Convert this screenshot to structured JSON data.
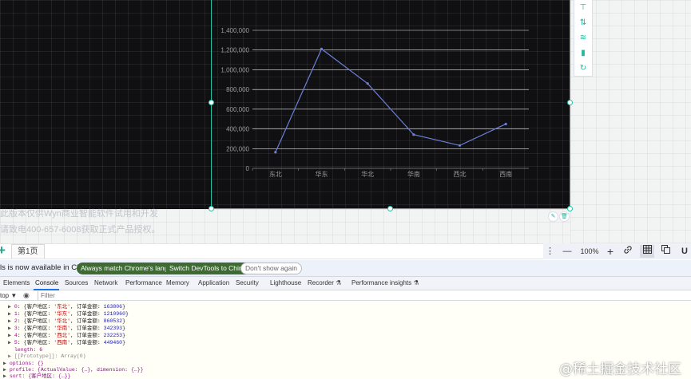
{
  "canvas": {
    "notice_line1": "此版本仅供Wyn商业智能软件试用和开发",
    "notice_line2": "请致电400-657-6008获取正式产品授权。",
    "side_toolbar": [
      {
        "icon": "filter-icon",
        "glyph": "⊤"
      },
      {
        "icon": "sort-icon",
        "glyph": "⇅"
      },
      {
        "icon": "analysis-icon",
        "glyph": "≋"
      },
      {
        "icon": "chart-type-icon",
        "glyph": "▮"
      },
      {
        "icon": "refresh-icon",
        "glyph": "↻"
      }
    ],
    "edit_glyph": "✎",
    "delete_glyph": "🗑"
  },
  "chart_data": {
    "type": "line",
    "categories": [
      "东北",
      "华东",
      "华北",
      "华南",
      "西北",
      "西南"
    ],
    "values": [
      163806,
      1210960,
      860532,
      342393,
      232253,
      449460
    ],
    "ylim": [
      0,
      1400000
    ],
    "y_ticks": [
      "0",
      "200,000",
      "400,000",
      "600,000",
      "800,000",
      "1,000,000",
      "1,200,000",
      "1,400,000"
    ],
    "grid": true,
    "colors": {
      "line": "#6a7fd6",
      "grid": "#e8e8e8"
    }
  },
  "page_bar": {
    "add_glyph": "+",
    "tab_label": "第1页",
    "devtools": {
      "more_glyph": "⋮",
      "zoom_out": "—",
      "zoom": "100%",
      "zoom_in": "+"
    }
  },
  "devtools": {
    "info_text": "ls is now available in Chinese!",
    "btn_match": "Always match Chrome's language",
    "btn_switch": "Switch DevTools to Chinese",
    "btn_dismiss": "Don't show again",
    "tabs": [
      "Elements",
      "Console",
      "Sources",
      "Network",
      "Performance",
      "Memory",
      "Application",
      "Security",
      "Lighthouse",
      "Recorder ⚗",
      "Performance insights ⚗"
    ],
    "active_tab": "Console",
    "context": "top ▼",
    "filter_placeholder": "Filter",
    "console_rows": [
      {
        "idx": "0",
        "region": "'东北'",
        "amount": "163806"
      },
      {
        "idx": "1",
        "region": "'华东'",
        "amount": "1210960"
      },
      {
        "idx": "2",
        "region": "'华北'",
        "amount": "860532"
      },
      {
        "idx": "3",
        "region": "'华南'",
        "amount": "342393"
      },
      {
        "idx": "4",
        "region": "'西北'",
        "amount": "232253"
      },
      {
        "idx": "5",
        "region": "'西南'",
        "amount": "449460"
      }
    ],
    "row_prefix": "{客户地区: ",
    "row_mid": ", 订单金额: ",
    "row_suffix": "}",
    "length_label": "length: 6",
    "prototype_label": "[[Prototype]]: Array(0)",
    "options_label": "options: {}",
    "profile_label": "profile: {ActualValue: {…}, dimension: {…}}",
    "sort_label": "sort: {客户地区: {…}}"
  },
  "watermark": "@稀土掘金技术社区",
  "colors": {
    "accent": "#1fc6a7",
    "devtools_blue": "#1a73e8",
    "pill_green": "#3d6b32"
  }
}
